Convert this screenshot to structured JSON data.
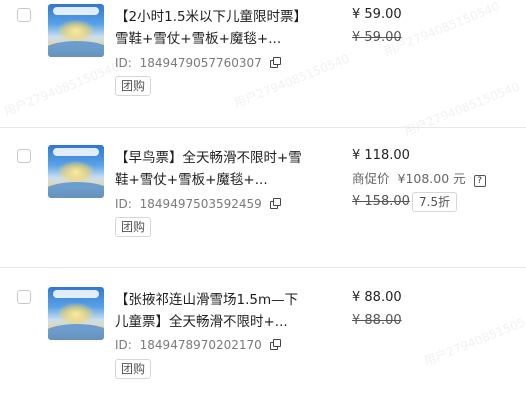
{
  "watermark_text": "用户2794085150540",
  "items": [
    {
      "title": "【2小时1.5米以下儿童限时票】雪鞋+雪仗+雪板+魔毯+...",
      "id_label": "ID:",
      "id": "1849479057760307",
      "tag": "团购",
      "price": "¥ 59.00",
      "original_price": "¥ 59.00"
    },
    {
      "title": "【早鸟票】全天畅滑不限时+雪鞋+雪仗+雪板+魔毯+...",
      "id_label": "ID:",
      "id": "1849497503592459",
      "tag": "团购",
      "price": "¥ 118.00",
      "promo_label": "商促价",
      "promo_price": "¥108.00 元",
      "help_symbol": "?",
      "original_price": "¥ 158.00",
      "discount": "7.5折"
    },
    {
      "title": "【张掖祁连山滑雪场1.5m—下儿童票】全天畅滑不限时+...",
      "id_label": "ID:",
      "id": "1849478970202170",
      "tag": "团购",
      "price": "¥ 88.00",
      "original_price": "¥ 88.00"
    }
  ]
}
